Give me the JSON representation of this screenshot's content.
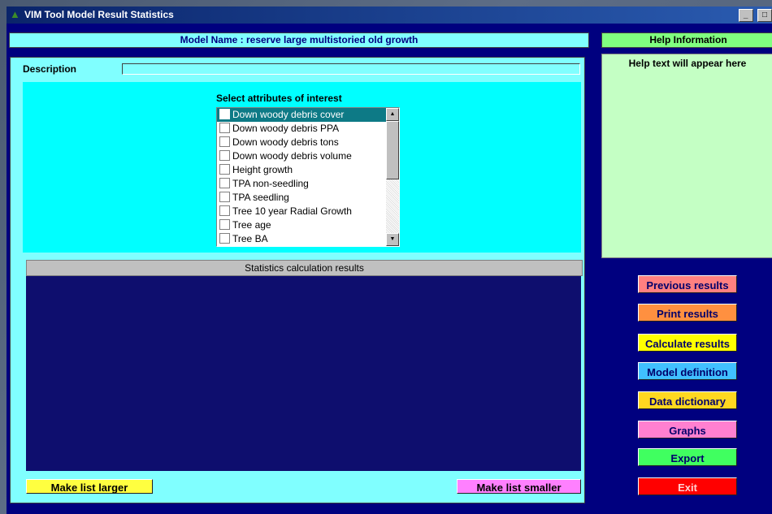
{
  "window": {
    "title": "VIM Tool Model Result Statistics",
    "title_icon": "tree-icon",
    "minimize": "_",
    "maximize": "□"
  },
  "model": {
    "label_and_name": "Model Name : reserve large multistoried old growth"
  },
  "help": {
    "title": "Help Information",
    "text": "Help text will appear here"
  },
  "description": {
    "label": "Description",
    "value": ""
  },
  "attributes": {
    "title": "Select attributes of interest",
    "items": [
      {
        "label": "Down woody debris cover",
        "checked": false,
        "selected": true
      },
      {
        "label": "Down woody debris PPA",
        "checked": false,
        "selected": false
      },
      {
        "label": "Down woody debris tons",
        "checked": false,
        "selected": false
      },
      {
        "label": "Down woody debris volume",
        "checked": false,
        "selected": false
      },
      {
        "label": "Height growth",
        "checked": false,
        "selected": false
      },
      {
        "label": "TPA non-seedling",
        "checked": false,
        "selected": false
      },
      {
        "label": "TPA seedling",
        "checked": false,
        "selected": false
      },
      {
        "label": "Tree 10 year Radial Growth",
        "checked": false,
        "selected": false
      },
      {
        "label": "Tree age",
        "checked": false,
        "selected": false
      },
      {
        "label": "Tree BA",
        "checked": false,
        "selected": false
      }
    ]
  },
  "stats": {
    "header": "Statistics calculation results"
  },
  "buttons": {
    "make_larger": "Make list larger",
    "make_smaller": "Make list smaller",
    "previous": "Previous results",
    "print": "Print results",
    "calculate": "Calculate results",
    "model_definition": "Model definition",
    "data_dictionary": "Data dictionary",
    "graphs": "Graphs",
    "export": "Export",
    "exit": "Exit"
  },
  "colors": {
    "window_bg": "#00007f",
    "panel_cyan": "#80ffff",
    "help_green": "#c4ffc4",
    "previous": "#ff8080",
    "print": "#ff9040",
    "calculate": "#ffff00",
    "model_definition": "#40c0ff",
    "data_dictionary": "#ffd820",
    "graphs": "#ff80d0",
    "export": "#40ff60",
    "exit": "#ff0000",
    "make_larger": "#ffff40",
    "make_smaller": "#ff80ff"
  }
}
